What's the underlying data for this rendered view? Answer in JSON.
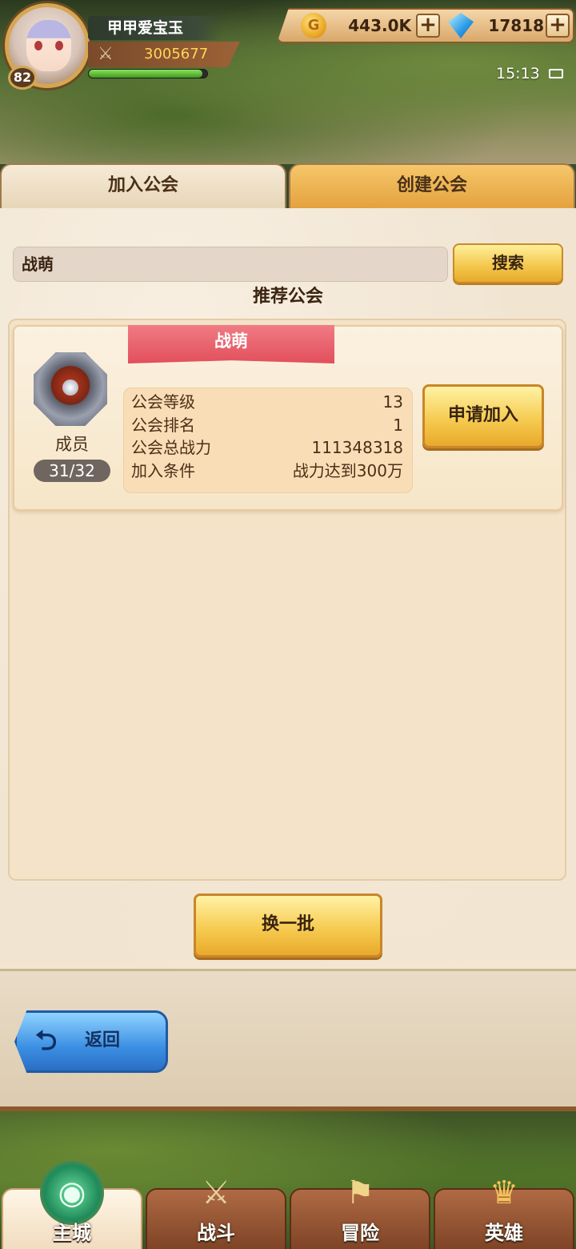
{
  "player": {
    "name": "甲甲爱宝玉",
    "level": "82",
    "power": "3005677",
    "exp_fraction": 0.96
  },
  "currency": {
    "gold": "443.0K",
    "diamonds": "17818",
    "coin_glyph": "G",
    "plus": "+"
  },
  "status": {
    "time": "15:13"
  },
  "tabs": {
    "join": "加入公会",
    "create": "创建公会"
  },
  "search": {
    "value": "战萌",
    "button": "搜索"
  },
  "section_title": "推荐公会",
  "guild": {
    "name": "战萌",
    "members_label": "成员",
    "members": "31/32",
    "rows": [
      {
        "label": "公会等级",
        "value": "13"
      },
      {
        "label": "公会排名",
        "value": "1"
      },
      {
        "label": "公会总战力",
        "value": "111348318"
      },
      {
        "label": "加入条件",
        "value": "战力达到300万"
      }
    ],
    "apply": "申请加入"
  },
  "refresh": "换一批",
  "back": "返回",
  "nav": [
    {
      "label": "主城",
      "icon": "city-icon",
      "glyph": "◉"
    },
    {
      "label": "战斗",
      "icon": "crossed-swords-icon",
      "glyph": "⚔"
    },
    {
      "label": "冒险",
      "icon": "map-scroll-icon",
      "glyph": "⚑"
    },
    {
      "label": "英雄",
      "icon": "hero-crest-icon",
      "glyph": "♛"
    }
  ],
  "colors": {
    "accent": "#f6cb52",
    "tab_active": "#e4a23e",
    "ribbon": "#e24f5c",
    "back": "#3b8fe3"
  }
}
